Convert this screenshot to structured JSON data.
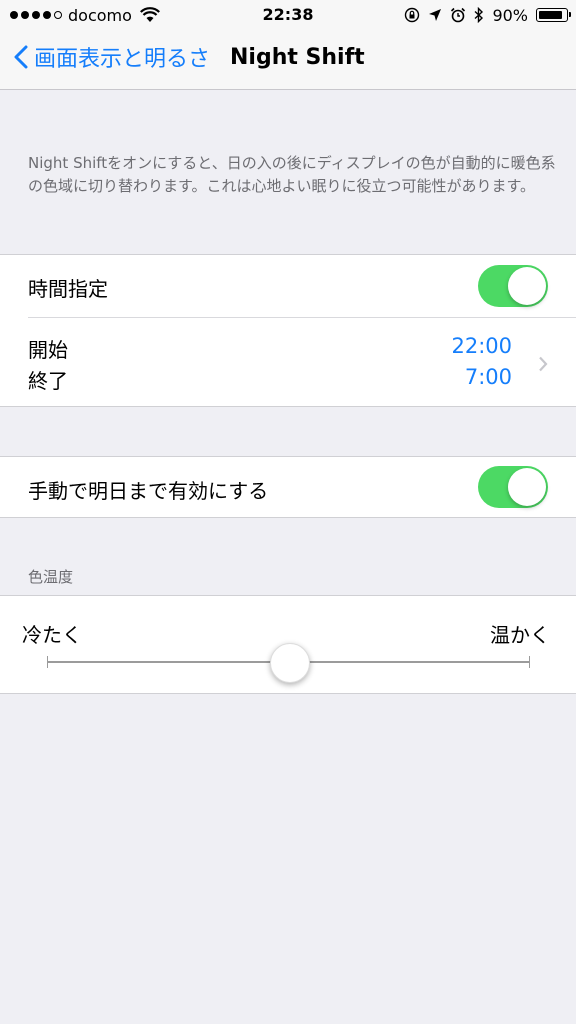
{
  "status_bar": {
    "carrier": "docomo",
    "time": "22:38",
    "battery": "90%",
    "battery_level": 0.9
  },
  "nav": {
    "back_label": "画面表示と明るさ",
    "title": "Night Shift"
  },
  "description": "Night Shiftをオンにすると、日の入の後にディスプレイの色が自動的に暖色系の色域に切り替わります。これは心地よい眠りに役立つ可能性があります。",
  "schedule": {
    "label": "時間指定",
    "enabled": true,
    "from_label": "開始",
    "to_label": "終了",
    "from_time": "22:00",
    "to_time": "7:00"
  },
  "manual": {
    "label": "手動で明日まで有効にする",
    "enabled": true
  },
  "temperature": {
    "header": "色温度",
    "less_label": "冷たく",
    "more_label": "温かく",
    "value": 0.5
  },
  "colors": {
    "accent": "#157efb",
    "toggle_on": "#4cd964",
    "background": "#efeff4"
  }
}
